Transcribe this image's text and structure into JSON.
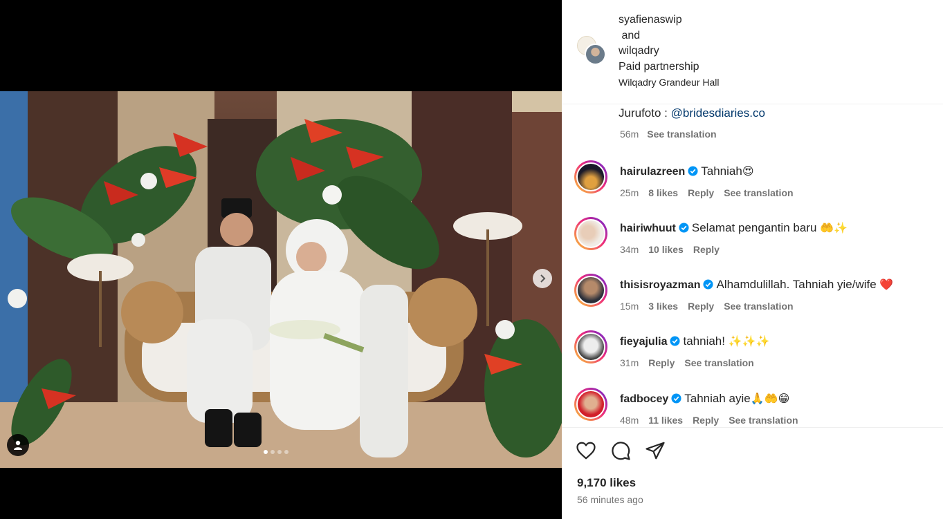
{
  "post": {
    "authors": [
      "syafienaswip",
      "wilqadry"
    ],
    "conjunction": "and",
    "partnership_label": "Paid partnership",
    "location": "Wilqadry Grandeur Hall"
  },
  "caption": {
    "prefix": "Jurufoto : ",
    "mention": "@bridesdiaries.co",
    "time": "56m",
    "see_translation": "See translation"
  },
  "comments": [
    {
      "user": "hairulazreen",
      "verified": true,
      "text": "Tahniah",
      "emoji": "😍",
      "time": "25m",
      "likes": "8 likes",
      "reply": "Reply",
      "see_translation": "See translation"
    },
    {
      "user": "hairiwhuut",
      "verified": true,
      "text": "Selamat pengantin baru ",
      "emoji": "🤲✨",
      "time": "34m",
      "likes": "10 likes",
      "reply": "Reply",
      "see_translation": ""
    },
    {
      "user": "thisisroyazman",
      "verified": true,
      "text": "Alhamdulillah. Tahniah yie/wife ",
      "emoji": "❤️",
      "time": "15m",
      "likes": "3 likes",
      "reply": "Reply",
      "see_translation": "See translation"
    },
    {
      "user": "fieyajulia",
      "verified": true,
      "text": "tahniah! ",
      "emoji": "✨✨✨",
      "time": "31m",
      "likes": "",
      "reply": "Reply",
      "see_translation": "See translation"
    },
    {
      "user": "fadbocey",
      "verified": true,
      "text": "Tahniah ayie",
      "emoji": "🙏🤲😁",
      "time": "48m",
      "likes": "11 likes",
      "reply": "Reply",
      "see_translation": "See translation"
    }
  ],
  "actions": {
    "like_icon": "heart-icon",
    "comment_icon": "comment-icon",
    "share_icon": "send-icon"
  },
  "likes_count": "9,170 likes",
  "posted_time": "56 minutes ago",
  "carousel": {
    "slide_count": 4,
    "active_slide": 1
  },
  "colors": {
    "link": "#00376b",
    "muted": "#737373",
    "verified": "#0095f6",
    "story_ring_start": "#f9ce34",
    "story_ring_end": "#6228d7"
  }
}
